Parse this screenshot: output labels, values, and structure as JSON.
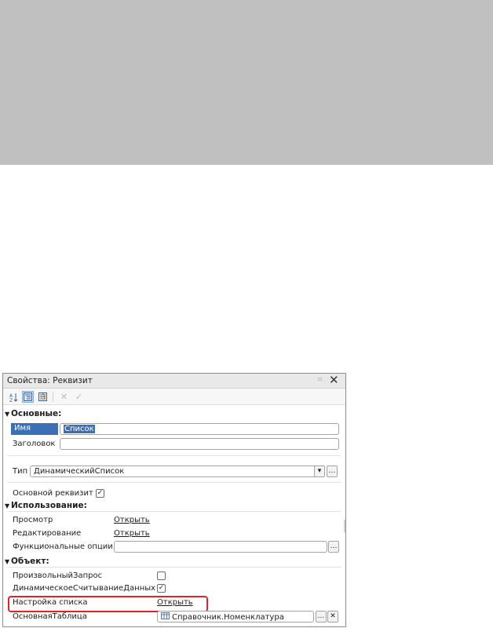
{
  "window": {
    "title": "Свойства: Реквизит"
  },
  "toolbar": {
    "buttons": [
      {
        "name": "sort-alphabetical",
        "icon": "sort-az-icon",
        "glyph": "A↓"
      },
      {
        "name": "sort-categories",
        "icon": "categories-icon",
        "glyph": "☰"
      },
      {
        "name": "filter",
        "icon": "filter-icon",
        "glyph": "▤"
      },
      {
        "name": "delete",
        "icon": "delete-icon",
        "glyph": "✕"
      },
      {
        "name": "confirm",
        "icon": "check-icon",
        "glyph": "✓"
      }
    ]
  },
  "sections": {
    "basic": "Основные:",
    "usage": "Использование:",
    "object": "Объект:"
  },
  "fields": {
    "name_label": "Имя",
    "name_value": "Список",
    "header_label": "Заголовок",
    "header_value": "",
    "type_label": "Тип",
    "type_value": "ДинамическийСписок",
    "main_attr_label": "Основной реквизит",
    "main_attr_checked": "✓",
    "view_label": "Просмотр",
    "view_link": "Открыть",
    "edit_label": "Редактирование",
    "edit_link": "Открыть",
    "func_options_label": "Функциональные опции",
    "custom_query_label": "ПроизвольныйЗапрос",
    "custom_query_checked": "",
    "dynamic_read_label": "ДинамическоеСчитываниеДанных",
    "dynamic_read_checked": "✓",
    "list_settings_label": "Настройка списка",
    "list_settings_link": "Открыть",
    "main_table_label": "ОсновнаяТаблица",
    "main_table_value": "Справочник.Номенклатура"
  },
  "colors": {
    "highlight": "#e0232a",
    "selection": "#3b6fb6"
  }
}
